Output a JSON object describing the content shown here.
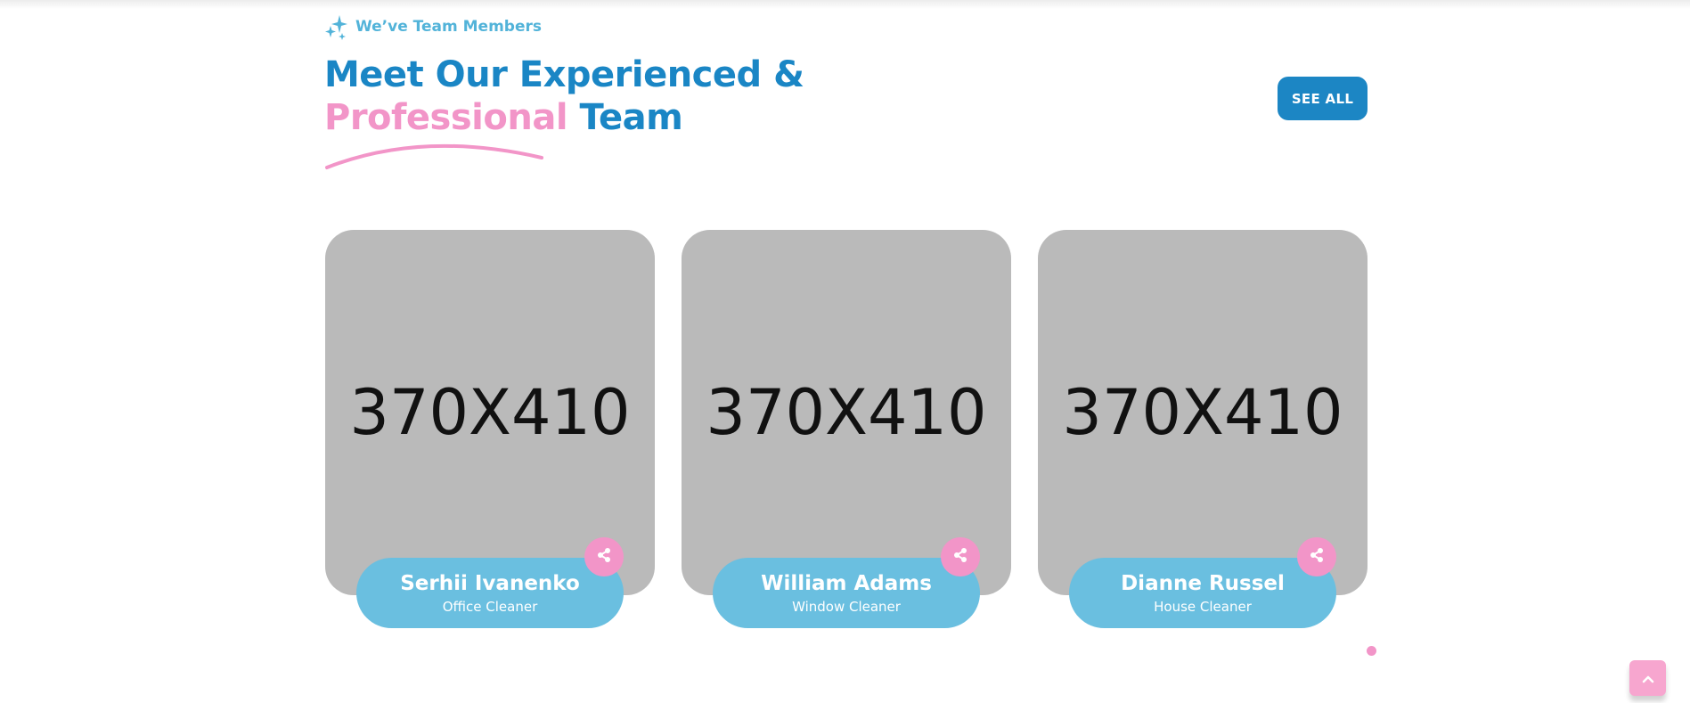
{
  "section": {
    "subtitle": "We’ve Team Members",
    "heading_line1": "Meet Our Experienced &",
    "heading_highlight": "Professional",
    "heading_rest": "Team",
    "see_all_label": "SEE ALL"
  },
  "team": [
    {
      "photo_text": "370X410",
      "name": "Serhii Ivanenko",
      "role": "Office Cleaner"
    },
    {
      "photo_text": "370X410",
      "name": "William Adams",
      "role": "Window Cleaner"
    },
    {
      "photo_text": "370X410",
      "name": "Dianne Russel",
      "role": "House Cleaner"
    }
  ],
  "colors": {
    "primary": "#1a86c5",
    "accent_pink": "#f295c8",
    "card_info": "#6abfe0",
    "photo_placeholder": "#bababa"
  },
  "icons": {
    "subtitle": "sparkle-icon",
    "share": "share-icon",
    "scroll_top": "chevron-up-icon"
  }
}
